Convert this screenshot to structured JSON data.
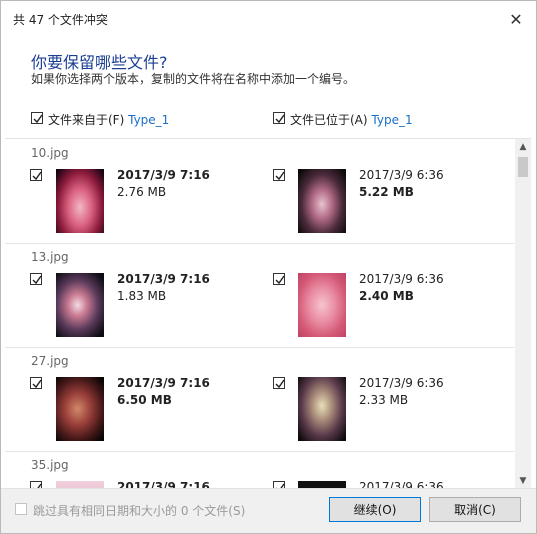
{
  "title": "共 47 个文件冲突",
  "heading": "你要保留哪些文件?",
  "subtext": "如果你选择两个版本，复制的文件将在名称中添加一个编号。",
  "source_column": {
    "label": "文件来自于(F)",
    "folder": "Type_1",
    "checked": true
  },
  "dest_column": {
    "label": "文件已位于(A)",
    "folder": "Type_1",
    "checked": true
  },
  "files": [
    {
      "name": "10.jpg",
      "source": {
        "date": "2017/3/9 7:16",
        "size": "2.76 MB",
        "checked": true
      },
      "dest": {
        "date": "2017/3/9 6:36",
        "size": "5.22 MB",
        "checked": true
      }
    },
    {
      "name": "13.jpg",
      "source": {
        "date": "2017/3/9 7:16",
        "size": "1.83 MB",
        "checked": true
      },
      "dest": {
        "date": "2017/3/9 6:36",
        "size": "2.40 MB",
        "checked": true
      }
    },
    {
      "name": "27.jpg",
      "source": {
        "date": "2017/3/9 7:16",
        "size": "6.50 MB",
        "checked": true
      },
      "dest": {
        "date": "2017/3/9 6:36",
        "size": "2.33 MB",
        "checked": true
      }
    },
    {
      "name": "35.jpg",
      "source": {
        "date": "2017/3/9 7:16",
        "size": "",
        "checked": true
      },
      "dest": {
        "date": "2017/3/9 6:36",
        "size": "",
        "checked": true
      }
    }
  ],
  "footer": {
    "skip_label": "跳过具有相同日期和大小的 0 个文件(S)",
    "continue_label": "继续(O)",
    "cancel_label": "取消(C)"
  },
  "icons": {
    "close": "close-icon",
    "check": "checkmark-icon",
    "scroll_up": "chevron-up-icon",
    "scroll_down": "chevron-down-icon"
  }
}
